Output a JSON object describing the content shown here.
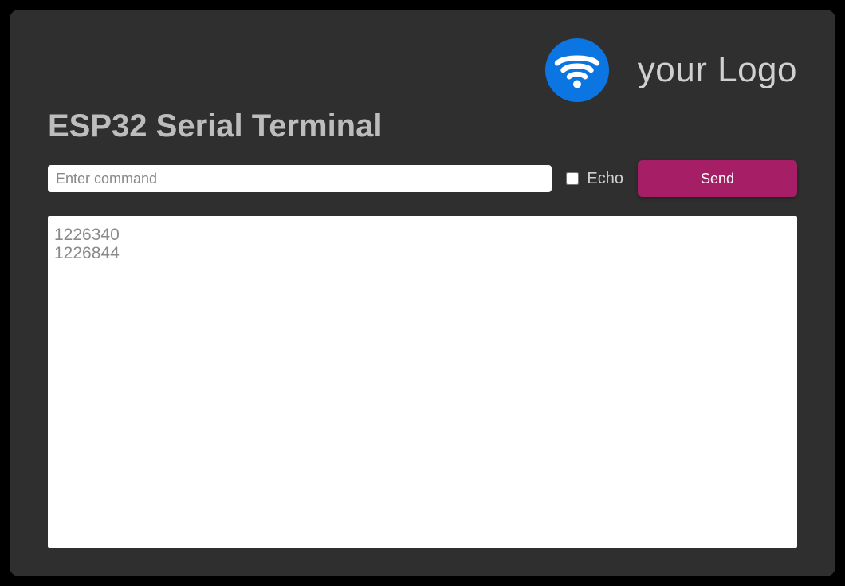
{
  "header": {
    "logo_text": "your Logo",
    "icon_name": "wifi-icon"
  },
  "title": "ESP32 Serial Terminal",
  "controls": {
    "command_placeholder": "Enter command",
    "command_value": "",
    "echo_label": "Echo",
    "echo_checked": false,
    "send_label": "Send"
  },
  "output_lines": [
    "1226340",
    "1226844"
  ],
  "colors": {
    "accent": "#a61e65",
    "wifi_bg": "#0b76e2",
    "panel_bg": "#2f2f2f"
  }
}
